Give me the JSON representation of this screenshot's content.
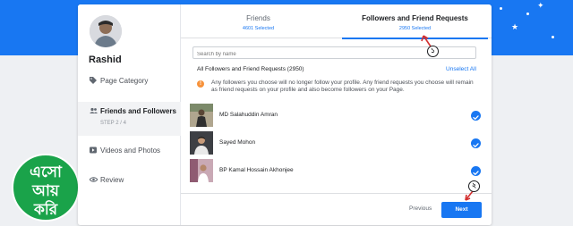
{
  "brand": {
    "logo_lines": [
      "এসো",
      "আয়",
      "করি"
    ]
  },
  "profile": {
    "name": "Rashid"
  },
  "sidebar": {
    "items": [
      {
        "label": "Page Category",
        "icon": "tag-icon"
      },
      {
        "label": "Friends and Followers",
        "step": "STEP 2 / 4",
        "icon": "people-icon",
        "active": true
      },
      {
        "label": "Videos and Photos",
        "icon": "video-icon"
      },
      {
        "label": "Review",
        "icon": "eye-icon"
      }
    ]
  },
  "tabs": [
    {
      "label": "Friends",
      "sub": "4601 Selected"
    },
    {
      "label": "Followers and Friend Requests",
      "sub": "2950 Selected",
      "active": true
    }
  ],
  "search": {
    "placeholder": "Search by name"
  },
  "list": {
    "title": "All Followers and Friend Requests (2950)",
    "unselect_all": "Unselect All",
    "notice": "Any followers you choose will no longer follow your profile. Any friend requests you choose will remain as friend requests on your profile and also become followers on your Page.",
    "rows": [
      {
        "name": "MD Salahuddin Amran"
      },
      {
        "name": "Sayed Mohon"
      },
      {
        "name": "BP Kamal Hossain Akhonjee"
      }
    ]
  },
  "footer": {
    "previous_label": "Previous",
    "next_label": "Next"
  },
  "annotations": [
    "১",
    "২"
  ],
  "colors": {
    "accent": "#1877f2",
    "logo_green": "#1aa34a",
    "warning": "#f7923b"
  }
}
